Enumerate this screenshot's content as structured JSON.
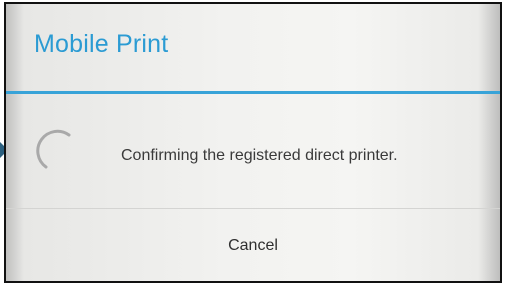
{
  "dialog": {
    "title": "Mobile Print",
    "message": "Confirming the registered direct printer.",
    "cancel_label": "Cancel"
  },
  "colors": {
    "accent": "#2b9bd3",
    "divider_accent": "#38a3d8",
    "text": "#3a3a3a"
  },
  "icons": {
    "spinner": "loading-spinner-icon",
    "pointer": "arrow-right-icon"
  }
}
